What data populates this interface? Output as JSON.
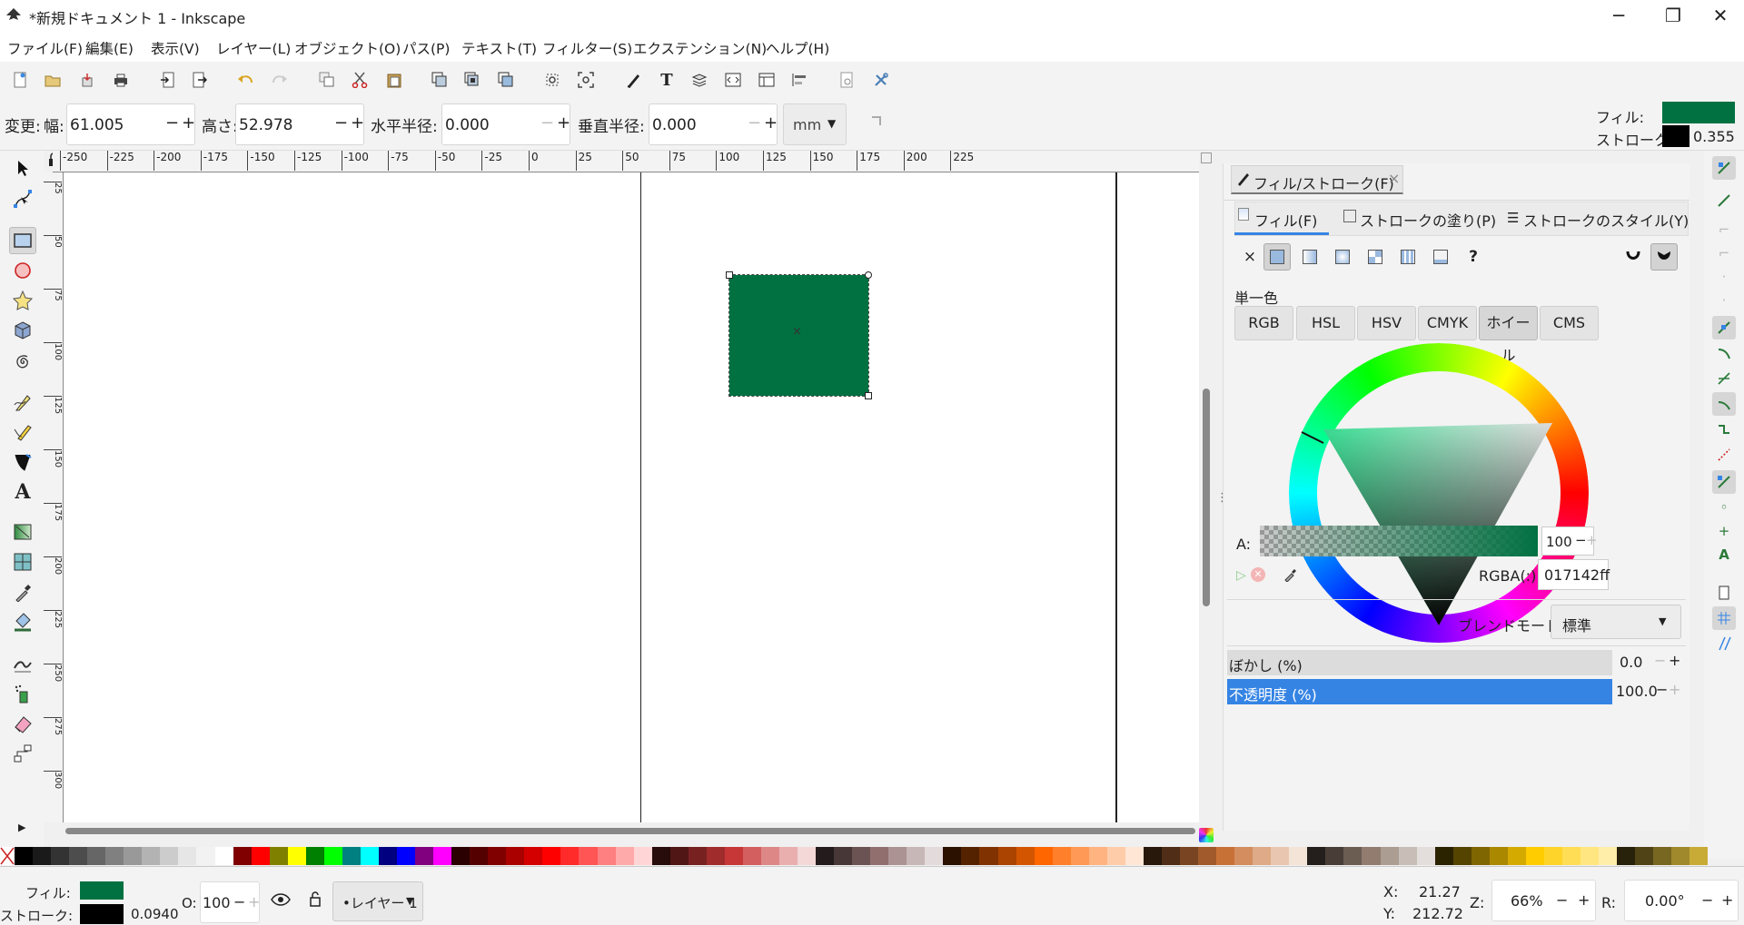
{
  "window": {
    "title": "*新規ドキュメント 1 - Inkscape",
    "minimize": "─",
    "maximize": "❐",
    "close": "✕"
  },
  "menu": [
    "ファイル(F)",
    "編集(E)",
    "表示(V)",
    "レイヤー(L)",
    "オブジェクト(O)",
    "パス(P)",
    "テキスト(T)",
    "フィルター(S)",
    "エクステンション(N)",
    "ヘルプ(H)"
  ],
  "commands": [
    "new-icon",
    "open-icon",
    "save-icon",
    "print-icon",
    "import-icon",
    "export-icon",
    "undo-icon",
    "redo-icon",
    "duplicate-icon",
    "cut-icon",
    "paste-icon",
    "group-icon",
    "ungroup-icon",
    "clone-icon",
    "zoom-selection-icon",
    "zoom-drawing-icon",
    "fill-stroke-icon",
    "text-icon",
    "layers-icon",
    "xml-icon",
    "align-icon",
    "objects-icon",
    "document-props-icon",
    "preferences-icon"
  ],
  "controls": {
    "change_label": "変更:",
    "width_label": "幅:",
    "width": "61.005",
    "height_label": "高さ:",
    "height": "52.978",
    "rx_label": "水平半径:",
    "rx": "0.000",
    "ry_label": "垂直半径:",
    "ry": "0.000",
    "unit": "mm",
    "minus": "−",
    "plus": "+"
  },
  "style_indicator": {
    "fill_label": "フィル:",
    "stroke_label": "ストローク:",
    "stroke_width": "0.355",
    "fill_color": "#017142",
    "stroke_color": "#000000"
  },
  "ruler": {
    "ticks": [
      "-250",
      "-225",
      "-200",
      "-175",
      "-150",
      "-125",
      "-100",
      "-75",
      "-50",
      "-25",
      "0",
      "25",
      "50",
      "75",
      "100",
      "125",
      "150",
      "175",
      "200",
      "225"
    ],
    "vticks": [
      "25",
      "50",
      "75",
      "100",
      "125",
      "150",
      "175",
      "200",
      "225",
      "250",
      "275",
      "300"
    ]
  },
  "tools": [
    "selector-icon",
    "node-icon",
    "rect-icon",
    "circle-icon",
    "star-icon",
    "3dbox-icon",
    "spiral-icon",
    "pen-icon",
    "pencil-icon",
    "calligraphy-icon",
    "text-tool-icon",
    "gradient-icon",
    "mesh-icon",
    "dropper-icon",
    "paint-bucket-icon",
    "tweak-icon",
    "spray-icon",
    "eraser-icon",
    "connector-icon"
  ],
  "panel": {
    "title": "フィル/ストローク(F)",
    "close": "×",
    "tabs": [
      "フィル(F)",
      "ストロークの塗り(P)",
      "ストロークのスタイル(Y)"
    ],
    "paint_none": "×",
    "paint_unknown": "?",
    "flat_label": "単一色",
    "modes": [
      "RGB",
      "HSL",
      "HSV",
      "CMYK",
      "ホイール",
      "CMS"
    ],
    "alpha_label": "A:",
    "alpha": "100",
    "rgba_label": "RGBA(:):",
    "rgba": "017142ff",
    "blend_label": "ブレンドモード:",
    "blend": "標準",
    "blur_label": "ぼかし (%)",
    "blur": "0.0",
    "opacity_label": "不透明度 (%)",
    "opacity": "100.0"
  },
  "status": {
    "fill_label": "フィル:",
    "stroke_label": "ストローク:",
    "stroke_width": "0.0940",
    "opacity_label": "O:",
    "opacity": "100",
    "layer": "•レイヤー 1",
    "x_label": "X:",
    "x": "21.27",
    "y_label": "Y:",
    "y": "212.72",
    "zoom_label": "Z:",
    "zoom": "66%",
    "rotate_label": "R:",
    "rotate": "0.00°"
  },
  "colors": {
    "accent": "#3584e4",
    "fill": "#017142"
  }
}
